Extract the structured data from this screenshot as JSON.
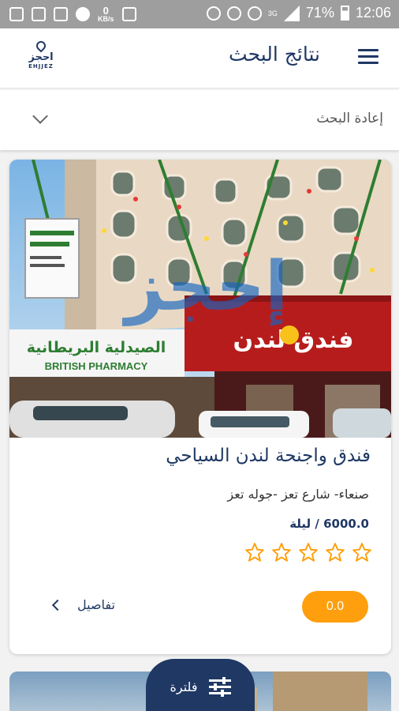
{
  "status_bar": {
    "speed_value": "0",
    "speed_unit": "KB/s",
    "network": "3G",
    "battery": "71%",
    "time": "12:06"
  },
  "header": {
    "title": "نتائج البحث",
    "logo_ar": "احجز",
    "logo_en": "EHJJEZ"
  },
  "research": {
    "label": "إعادة البحث"
  },
  "listing": {
    "name": "فندق واجنحة لندن السياحي",
    "address": "صنعاء- شارع تعز -جوله تعز",
    "price": "6000.0 / ليلة",
    "rating": "0.0",
    "stars_total": 5,
    "stars_filled": 0,
    "details_label": "تفاصيل",
    "photo": {
      "sign_pharmacy_ar": "الصيدلية البريطانية",
      "sign_pharmacy_en": "BRITISH PHARMACY",
      "sign_hotel_ar": "فندق لندن",
      "watermark": "إحجز"
    }
  },
  "filter": {
    "label": "فلترة"
  },
  "colors": {
    "navy": "#1f3864",
    "accent_orange": "#ff9f0d",
    "status_bar": "#9e9e9e"
  }
}
